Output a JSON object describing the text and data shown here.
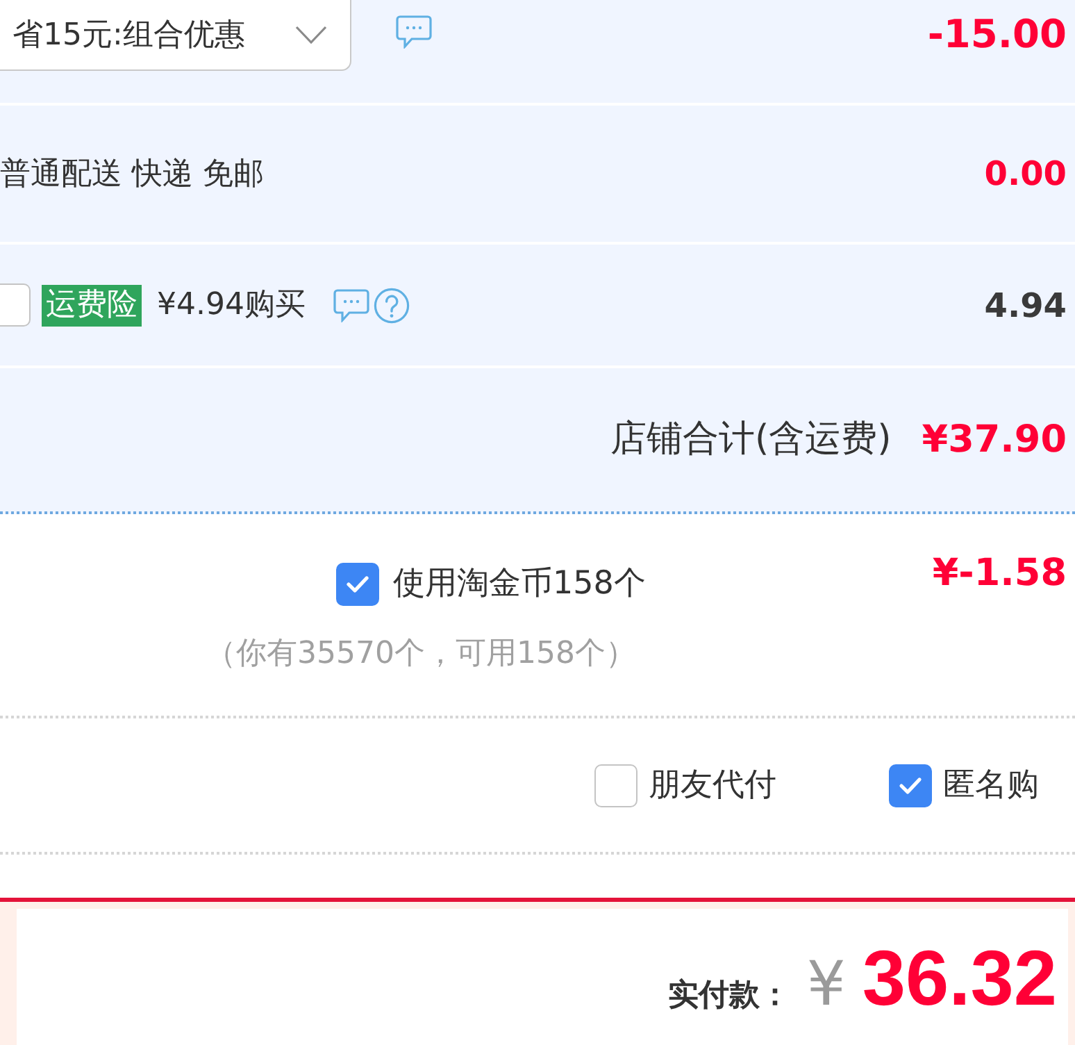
{
  "shop": {
    "promotion": {
      "value": "省15元:组合优惠",
      "amount": "-15.00"
    },
    "shipping": {
      "method": "普通配送 快递 免邮",
      "amount": "0.00"
    },
    "insurance": {
      "checked": false,
      "tag": "运费险",
      "offer": "¥4.94购买",
      "amount": "4.94"
    },
    "subtotal": {
      "label": "店铺合计(含运费)",
      "amount": "¥37.90"
    }
  },
  "coins": {
    "checked": true,
    "label": "使用淘金币158个",
    "note": "（你有35570个，可用158个）",
    "amount": "¥-1.58"
  },
  "options": [
    {
      "label": "朋友代付",
      "checked": false
    },
    {
      "label": "匿名购",
      "checked": true
    }
  ],
  "payment": {
    "label": "实付款：",
    "currency": "¥",
    "amount": "36.32"
  }
}
